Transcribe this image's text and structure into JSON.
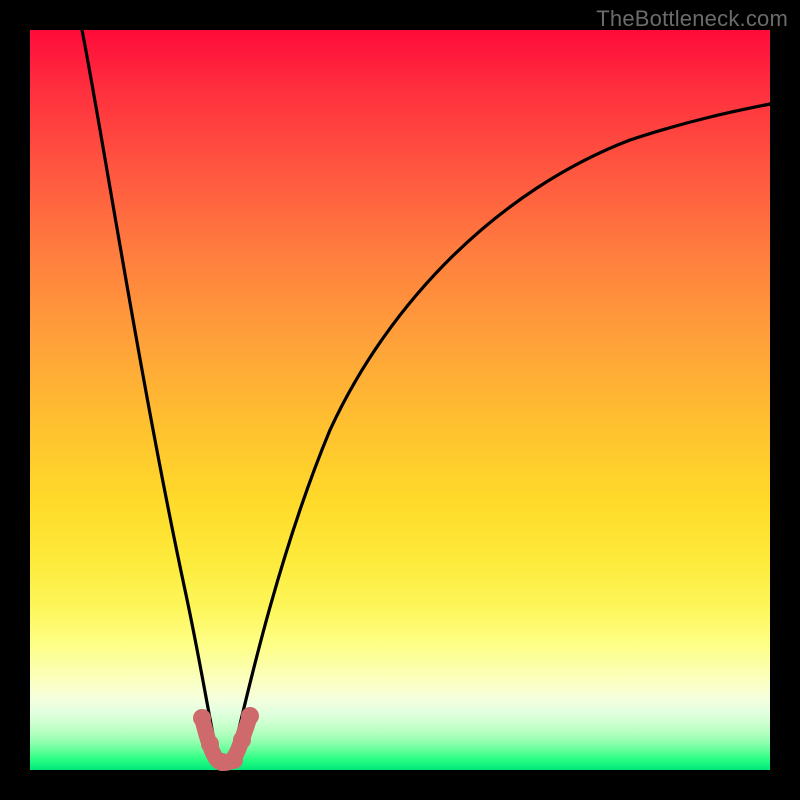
{
  "watermark": {
    "text": "TheBottleneck.com"
  },
  "chart_data": {
    "type": "line",
    "title": "",
    "xlabel": "",
    "ylabel": "",
    "xlim": [
      0,
      100
    ],
    "ylim": [
      0,
      100
    ],
    "grid": false,
    "legend": false,
    "background_gradient": {
      "orientation": "vertical",
      "stops": [
        {
          "pos": 0.0,
          "color": "#ff0b3a"
        },
        {
          "pos": 0.3,
          "color": "#ff7d3e"
        },
        {
          "pos": 0.6,
          "color": "#ffd22a"
        },
        {
          "pos": 0.85,
          "color": "#feff9a"
        },
        {
          "pos": 1.0,
          "color": "#00e87a"
        }
      ]
    },
    "series": [
      {
        "name": "bottleneck-curve",
        "color": "#000000",
        "x": [
          5,
          8,
          11,
          14,
          17,
          20,
          22,
          23.5,
          25,
          26,
          27.5,
          30,
          33,
          38,
          45,
          55,
          65,
          75,
          85,
          95,
          100
        ],
        "values": [
          100,
          85,
          70,
          55,
          40,
          25,
          12,
          5,
          2,
          5,
          12,
          25,
          38,
          52,
          63,
          73,
          79,
          83,
          86,
          88,
          89
        ]
      },
      {
        "name": "highlight-minimum",
        "color": "#d66a6a",
        "style": "thick-dots",
        "x": [
          22.5,
          23.5,
          24.5,
          25.0,
          25.5,
          26.5,
          27.5
        ],
        "values": [
          6.0,
          3.0,
          1.5,
          1.2,
          1.5,
          3.0,
          6.0
        ]
      }
    ],
    "annotations": []
  }
}
